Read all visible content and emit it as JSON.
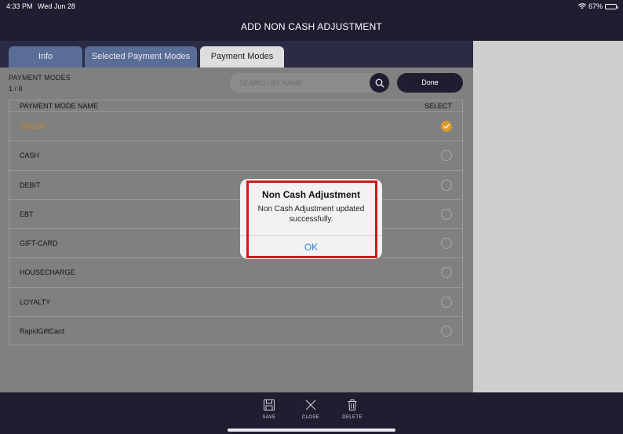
{
  "status_bar": {
    "time": "4:33 PM",
    "date": "Wed Jun 28",
    "battery": "67%"
  },
  "header": {
    "title": "ADD NON CASH ADJUSTMENT"
  },
  "tabs": [
    {
      "label": "Info"
    },
    {
      "label": "Selected Payment Modes"
    },
    {
      "label": "Payment Modes"
    }
  ],
  "panel": {
    "label": "PAYMENT MODES",
    "count": "1 / 8",
    "search_placeholder": "SEARCH BY NAME",
    "done_label": "Done"
  },
  "table": {
    "col_name": "PAYMENT MODE NAME",
    "col_select": "SELECT",
    "rows": [
      {
        "name": "CREDIT",
        "selected": true
      },
      {
        "name": "CASH",
        "selected": false
      },
      {
        "name": "DEBIT",
        "selected": false
      },
      {
        "name": "EBT",
        "selected": false
      },
      {
        "name": "GIFT-CARD",
        "selected": false
      },
      {
        "name": "HOUSECHARGE",
        "selected": false
      },
      {
        "name": "LOYALTY",
        "selected": false
      },
      {
        "name": "RapidGiftCard",
        "selected": false
      }
    ]
  },
  "alert": {
    "title": "Non Cash Adjustment",
    "message": "Non Cash Adjustment updated successfully.",
    "ok_label": "OK"
  },
  "bottom_bar": {
    "save_label": "SAVE",
    "close_label": "CLOSE",
    "delete_label": "DELETE"
  },
  "colors": {
    "accent": "#d99a2b",
    "dark": "#1e1e30",
    "link": "#2f7fd6",
    "highlight": "#d4161a"
  }
}
